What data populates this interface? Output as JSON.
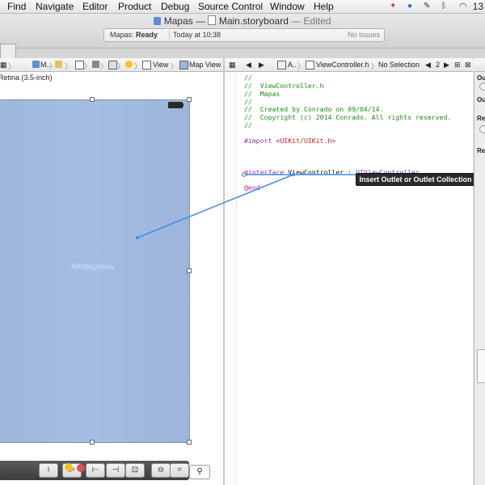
{
  "menubar": {
    "items": [
      "Find",
      "Navigate",
      "Editor",
      "Product",
      "Debug",
      "Source Control",
      "Window",
      "Help"
    ],
    "clock": "13"
  },
  "window": {
    "project": "Mapas",
    "separator": "—",
    "file": "Main.storyboard",
    "edited": "— Edited"
  },
  "activity": {
    "app": "Mapas:",
    "status": "Ready",
    "time": "Today at 10:38",
    "issues": "No Issues"
  },
  "jumpbar_left": {
    "items": [
      "M..",
      "View",
      "Map View"
    ]
  },
  "jumpbar_right": {
    "items": [
      "A..",
      "ViewController.h",
      "No Selection",
      "2"
    ]
  },
  "canvas": {
    "device_hint": "Retina (3.5-inch)",
    "map_view_label": "MKMapView"
  },
  "code": {
    "lines": [
      "//",
      "//  ViewController.h",
      "//  Mapas",
      "//",
      "//  Created by Conrado on 09/04/14.",
      "//  Copyright (c) 2014 Conrado. All rights reserved.",
      "//"
    ],
    "import_kw": "#import ",
    "import_file": "<UIKit/UIKit.h>",
    "interface_kw": "@interface",
    "class_name": " ViewController : ",
    "superclass": "UIViewController",
    "end_kw": "@end"
  },
  "tooltip": {
    "text": "Insert Outlet or Outlet Collection"
  },
  "inspector": {
    "labels": [
      "Ou",
      "Ou",
      "Re",
      "Re"
    ]
  },
  "colors": {
    "map_fill": "#a6bde2",
    "connection_line": "#3f8ee8",
    "comment": "#1d8c12",
    "keyword": "#a92d9a",
    "string": "#c41a16"
  }
}
